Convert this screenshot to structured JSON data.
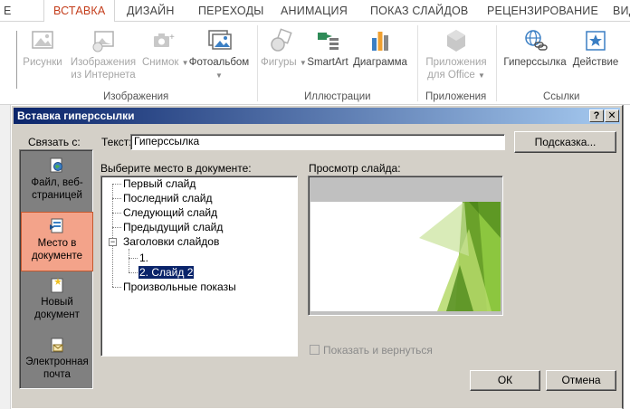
{
  "ribbon": {
    "tabs": [
      "Е",
      "ВСТАВКА",
      "ДИЗАЙН",
      "ПЕРЕХОДЫ",
      "АНИМАЦИЯ",
      "ПОКАЗ СЛАЙДОВ",
      "РЕЦЕНЗИРОВАНИЕ",
      "ВИДЕ"
    ],
    "active_tab": "ВСТАВКА",
    "buttons": {
      "pictures": "Рисунки",
      "online_pictures_1": "Изображения",
      "online_pictures_2": "из Интернета",
      "screenshot": "Снимок",
      "photo_album": "Фотоальбом",
      "shapes": "Фигуры",
      "smartart": "SmartArt",
      "chart": "Диаграмма",
      "apps_1": "Приложения",
      "apps_2": "для Office",
      "hyperlink": "Гиперссылка",
      "action": "Действие"
    },
    "groups": {
      "images": "Изображения",
      "illustrations": "Иллюстрации",
      "apps": "Приложения",
      "links": "Ссылки"
    }
  },
  "dialog": {
    "title": "Вставка гиперссылки",
    "help_button": "?",
    "close_button": "✕",
    "link_to_label": "Связать с:",
    "link_options": [
      {
        "line1": "Файл, веб-",
        "line2": "страницей"
      },
      {
        "line1": "Место в",
        "line2": "документе"
      },
      {
        "line1": "Новый",
        "line2": "документ"
      },
      {
        "line1": "Электронная",
        "line2": "почта"
      }
    ],
    "text_label": "Текст:",
    "text_value": "Гиперссылка",
    "hint_button": "Подсказка...",
    "place_label": "Выберите место в документе:",
    "tree": {
      "first": "Первый слайд",
      "last": "Последний слайд",
      "next": "Следующий слайд",
      "prev": "Предыдущий слайд",
      "headings": "Заголовки слайдов",
      "expander": "−",
      "slide1": "1.",
      "slide2": "2. Слайд 2",
      "custom": "Произвольные показы"
    },
    "preview_label": "Просмотр слайда:",
    "show_and_return": "Показать и вернуться",
    "ok": "ОК",
    "cancel": "Отмена"
  },
  "colors": {
    "accent": "#c43e1c",
    "title_gradient_start": "#0a246a",
    "title_gradient_end": "#a6caf0",
    "selection_orange": "#f3a38a",
    "slide_green": "#8cc63f"
  }
}
